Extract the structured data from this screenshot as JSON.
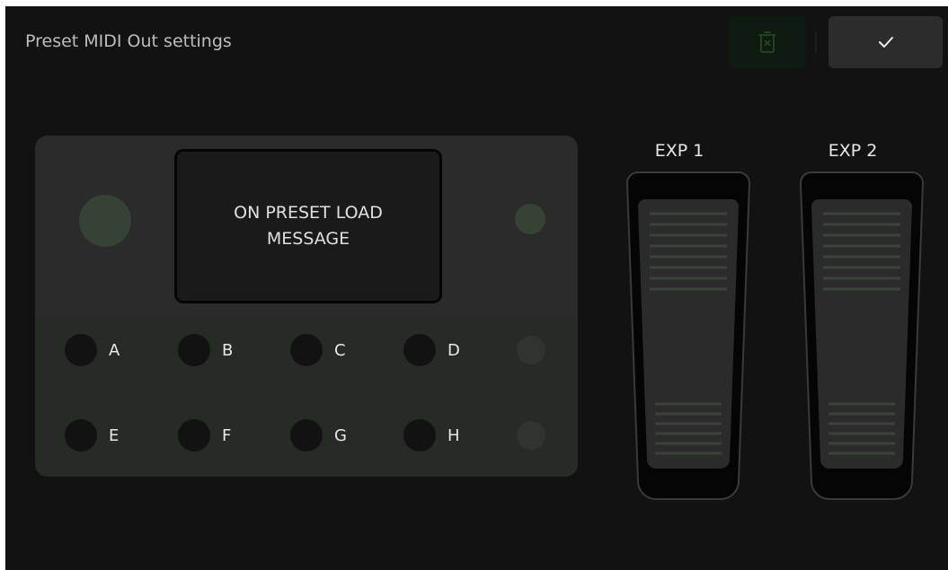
{
  "header": {
    "title": "Preset MIDI Out settings",
    "delete_icon": "trash-x-icon",
    "confirm_icon": "checkmark-icon"
  },
  "preset_screen": {
    "label": "ON PRESET LOAD MESSAGE"
  },
  "switches": [
    {
      "label": "A"
    },
    {
      "label": "B"
    },
    {
      "label": "C"
    },
    {
      "label": "D"
    },
    {
      "label": "E"
    },
    {
      "label": "F"
    },
    {
      "label": "G"
    },
    {
      "label": "H"
    }
  ],
  "expression_pedals": [
    {
      "label": "EXP 1"
    },
    {
      "label": "EXP 2"
    }
  ],
  "colors": {
    "background": "#121212",
    "panel": "#2b2b2b",
    "panel_bottom": "#262b26",
    "accent_knob": "#364236",
    "delete_button": "#0f1a10",
    "confirm_button": "#2c2c2c"
  }
}
